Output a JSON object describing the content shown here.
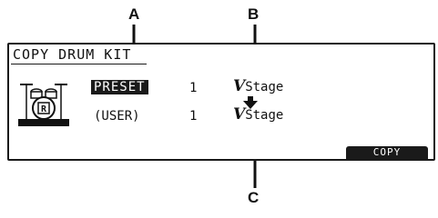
{
  "callouts": {
    "a": "A",
    "b": "B",
    "c": "C"
  },
  "screen": {
    "title": "COPY DRUM KIT",
    "source": {
      "group": "PRESET",
      "number": "1",
      "kit_name": "Stage"
    },
    "destination": {
      "group": "(USER)",
      "number": "1",
      "kit_name": "Stage"
    },
    "function_button": "COPY"
  },
  "icons": {
    "kit": "drum-kit-icon",
    "mark": "v-logo-icon",
    "arrow": "down-arrow-icon"
  }
}
